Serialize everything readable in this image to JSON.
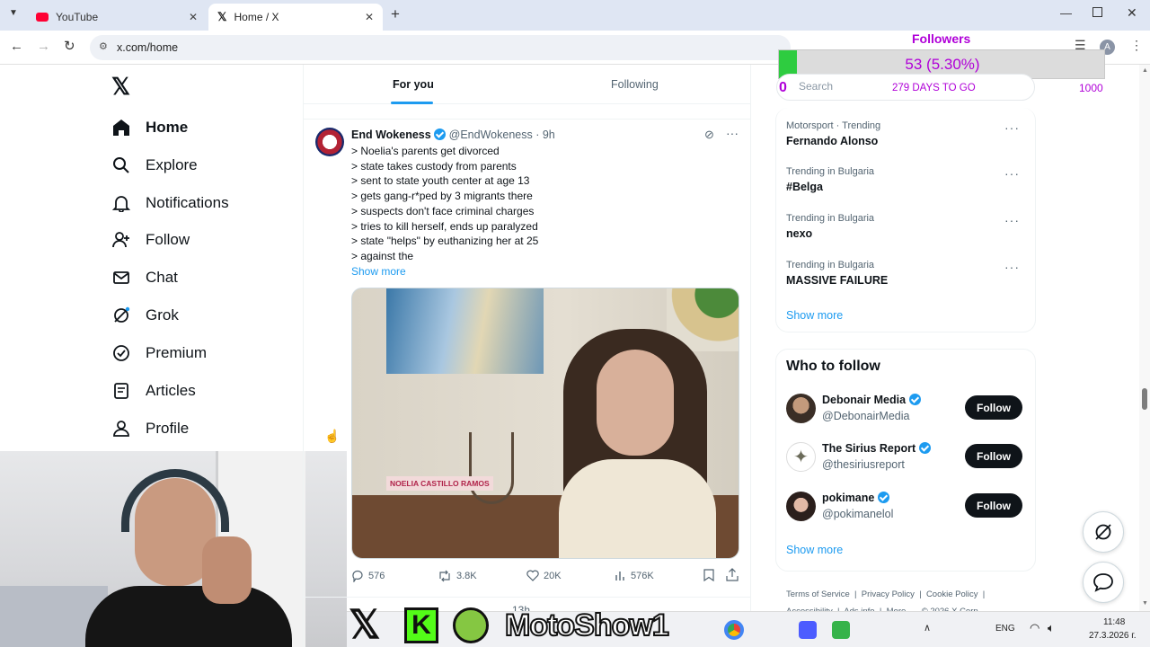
{
  "browser": {
    "tabs": [
      {
        "title": "YouTube",
        "icon": "youtube-icon"
      },
      {
        "title": "Home / X",
        "icon": "x-logo-icon"
      }
    ],
    "url": "x.com/home"
  },
  "sidebar": {
    "items": [
      {
        "label": "Home",
        "icon": "home-icon"
      },
      {
        "label": "Explore",
        "icon": "search-icon"
      },
      {
        "label": "Notifications",
        "icon": "bell-icon"
      },
      {
        "label": "Follow",
        "icon": "follow-icon"
      },
      {
        "label": "Chat",
        "icon": "mail-icon"
      },
      {
        "label": "Grok",
        "icon": "grok-icon"
      },
      {
        "label": "Premium",
        "icon": "premium-icon"
      },
      {
        "label": "Articles",
        "icon": "articles-icon"
      },
      {
        "label": "Profile",
        "icon": "profile-icon"
      }
    ]
  },
  "feed": {
    "tabs": [
      "For you",
      "Following"
    ],
    "tweet": {
      "author": "End Wokeness",
      "handle": "@EndWokeness",
      "time": "· 9h",
      "lines": [
        "> Noelia's parents get divorced",
        "> state takes custody from parents",
        "> sent to state youth center at age 13",
        "> gets gang-r*ped by 3 migrants there",
        "> suspects don't face criminal charges",
        "> tries to kill herself, ends up paralyzed",
        "> state \"helps\" by euthanizing her at 25",
        "> against the"
      ],
      "show_more": "Show more",
      "image_caption": "NOELIA CASTILLO RAMOS",
      "stats": {
        "replies": "576",
        "reposts": "3.8K",
        "likes": "20K",
        "views": "576K"
      }
    },
    "next_tweet_time": "13h"
  },
  "overlay": {
    "title": "Followers",
    "value": "53 (5.30%)",
    "progress": 0.053,
    "min": "0",
    "max": "1000",
    "days": "279 DAYS TO GO",
    "search_placeholder": "Search",
    "bar_color": "#2ecc40",
    "text_color": "#b000d8"
  },
  "trends": [
    {
      "category": "Motorsport · Trending",
      "name": "Fernando Alonso"
    },
    {
      "category": "Trending in Bulgaria",
      "name": "#Belga"
    },
    {
      "category": "Trending in Bulgaria",
      "name": "nexo"
    },
    {
      "category": "Trending in Bulgaria",
      "name": "MASSIVE FAILURE"
    }
  ],
  "trends_show_more": "Show more",
  "who_to_follow": {
    "title": "Who to follow",
    "accounts": [
      {
        "name": "Debonair Media",
        "handle": "@DebonairMedia",
        "button": "Follow"
      },
      {
        "name": "The Sirius Report",
        "handle": "@thesiriusreport",
        "button": "Follow"
      },
      {
        "name": "pokimane",
        "handle": "@pokimanelol",
        "button": "Follow"
      }
    ],
    "show_more": "Show more"
  },
  "footer": [
    "Terms of Service",
    "|",
    "Privacy Policy",
    "|",
    "Cookie Policy",
    "|",
    "Accessibility",
    "|",
    "Ads info",
    "|",
    "More ···",
    "© 2026 X Corp."
  ],
  "stream_banner": "MotoShow1",
  "taskbar": {
    "lang": "ENG",
    "time": "11:48",
    "date": "27.3.2026 г."
  }
}
